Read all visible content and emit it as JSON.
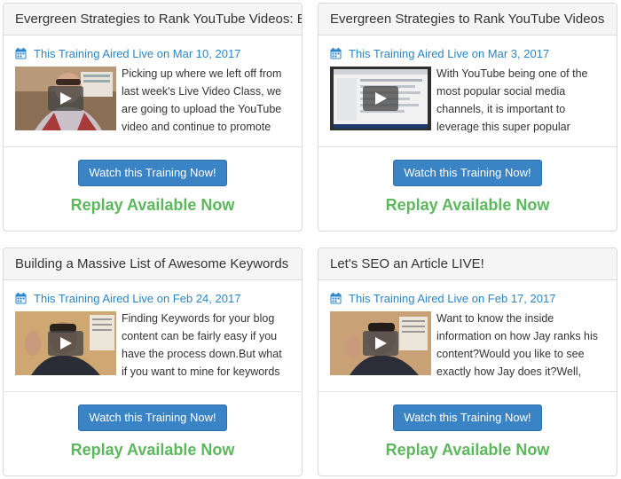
{
  "cards": [
    {
      "title": "Evergreen Strategies to Rank YouTube Videos: E",
      "aired": "This Training Aired Live on Mar 10, 2017",
      "excerpt": "Picking up where we left off from last week's Live Video Class, we are going to upload the YouTube video and continue to promote",
      "button": "Watch this Training Now!",
      "status": "Replay Available Now"
    },
    {
      "title": "Evergreen Strategies to Rank YouTube Videos",
      "aired": "This Training Aired Live on Mar 3, 2017",
      "excerpt": "With YouTube being one of the most popular social media channels, it is important to leverage this super popular",
      "button": "Watch this Training Now!",
      "status": "Replay Available Now"
    },
    {
      "title": "Building a Massive List of Awesome Keywords",
      "aired": "This Training Aired Live on Feb 24, 2017",
      "excerpt": "Finding Keywords for your blog content can be fairly easy if you have the process down.But what if you want to mine for keywords",
      "button": "Watch this Training Now!",
      "status": "Replay Available Now"
    },
    {
      "title": "Let's SEO an Article LIVE!",
      "aired": "This Training Aired Live on Feb 17, 2017",
      "excerpt": "Want to know the inside information on how Jay ranks his content?Would you like to see exactly how Jay does it?Well,",
      "button": "Watch this Training Now!",
      "status": "Replay Available Now"
    }
  ],
  "colors": {
    "link_blue": "#2a86c6",
    "button_blue": "#3a83c5",
    "replay_green": "#5cb85c",
    "header_bg": "#f5f5f5"
  },
  "icons": {
    "date": "calendar-icon",
    "thumbnail_overlay": "play-icon"
  }
}
